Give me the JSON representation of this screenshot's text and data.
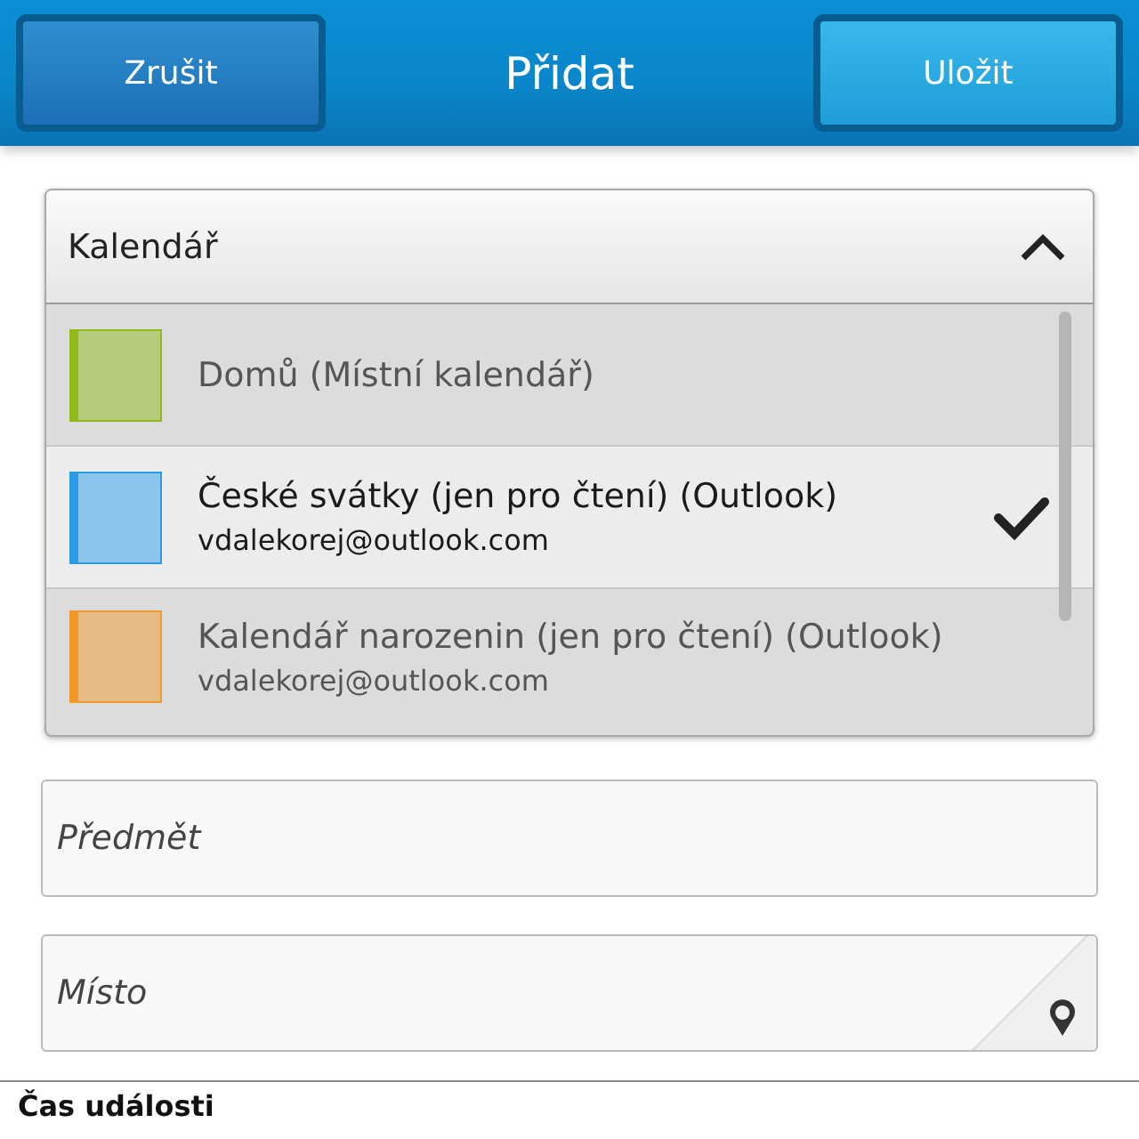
{
  "header": {
    "cancel_button": "Zrušit",
    "title": "Přidat",
    "save_button": "Uložit"
  },
  "calendar_dropdown": {
    "label": "Kalendář",
    "expanded": true,
    "items": [
      {
        "title": "Domů (Místní kalendář)",
        "color": "#8fba1a",
        "selected": false
      },
      {
        "title": "České svátky (jen pro čtení) (Outlook)",
        "subtitle": "vdalekorej@outlook.com",
        "color": "#2a9be8",
        "selected": true
      },
      {
        "title": "Kalendář narozenin (jen pro čtení) (Outlook)",
        "subtitle": "vdalekorej@outlook.com",
        "color": "#f0982a",
        "selected": false
      }
    ]
  },
  "fields": [
    {
      "placeholder": "Předmět",
      "kind": "text"
    },
    {
      "placeholder": "Místo",
      "kind": "location"
    }
  ],
  "section_title": "Čas události"
}
